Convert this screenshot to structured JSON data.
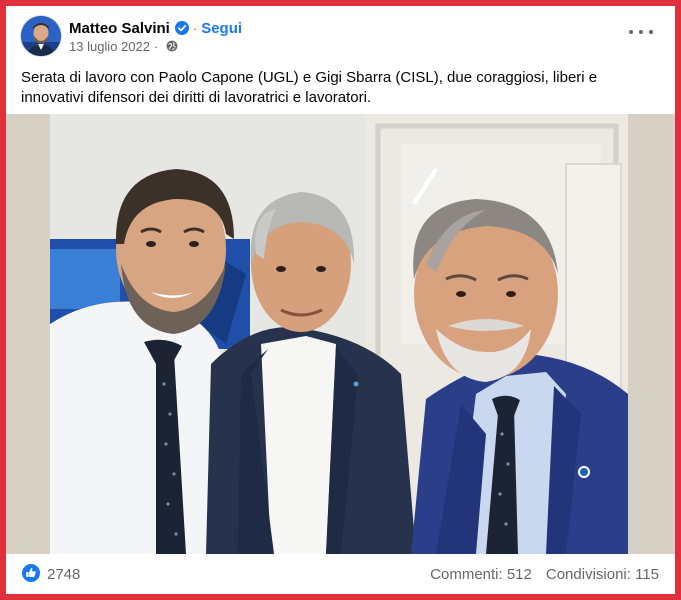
{
  "post": {
    "author": "Matteo Salvini",
    "follow_label": "Segui",
    "separator": "·",
    "date": "13 luglio 2022",
    "privacy_icon": "globe-icon",
    "verified_icon": "verified-badge-icon",
    "menu_icon": "more-options-icon",
    "caption": "Serata di lavoro con Paolo Capone (UGL) e Gigi Sbarra (CISL), due coraggiosi, liberi e innovativi difensori dei diritti di lavoratrici e lavoratori."
  },
  "stats": {
    "like_icon": "like-icon",
    "likes": "2748",
    "comments": "Commenti: 512",
    "shares": "Condivisioni: 115"
  },
  "colors": {
    "accent": "#1877f2",
    "frame": "#e0303b",
    "meta_text": "#65676b"
  }
}
